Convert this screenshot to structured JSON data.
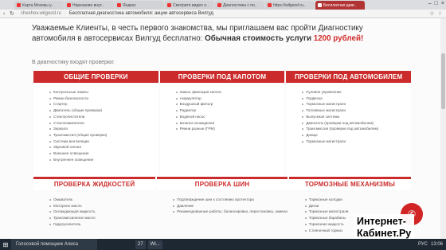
{
  "browser": {
    "tabs": [
      {
        "label": "Карта Москвы у.."
      },
      {
        "label": "Нарезание внут.."
      },
      {
        "label": "Яндекс"
      },
      {
        "label": "Смотрите видео о.."
      },
      {
        "label": "Диагностика с по.."
      },
      {
        "label": "https://wilgood.ru.."
      },
      {
        "label": "Бесплатная диаг.."
      }
    ],
    "active_tab_index": 6,
    "window_controls": [
      "–",
      "□",
      "×"
    ],
    "url": "chexhov.wilgood.ru",
    "page_title": "Бесплатная диагностика автомобиля: акции автосервиса Вилгуд"
  },
  "page": {
    "intro_text": "Уважаемые Клиенты, в честь первого знакомства, мы приглашаем вас пройти Диагностику автомобиля в автосервисах Вилгуд бесплатно:",
    "intro_bold": "Обычная стоимость услуги",
    "intro_price": "1200 рублей!",
    "diagnostics_caption": "В диагностику входят проверки:",
    "top_sections": [
      {
        "title": "ОБЩИЕ ПРОВЕРКИ",
        "items": [
          "Контрольные лампы",
          "Ремни безопасности",
          "Стартер",
          "Двигатель (общие проверки)",
          "Стеклоочистители",
          "Стеклоомыватели",
          "Зеркала",
          "Трансмиссия (общие проверки)",
          "Система вентиляции",
          "Звуковой сигнал",
          "Внешнее освещение",
          "Внутреннее освещение"
        ]
      },
      {
        "title": "ПРОВЕРКИ ПОД КАПОТОМ",
        "items": [
          "Замок, фиксация капота",
          "Аккумулятор",
          "Воздушный фильтр",
          "Радиатор",
          "Водяной насос",
          "Шланги охлаждения",
          "Ремни разные (ГРМ)"
        ]
      },
      {
        "title": "ПРОВЕРКИ ПОД АВТОМОБИЛЕМ",
        "items": [
          "Рулевое управление",
          "Подвеска",
          "Тормозные магистрали",
          "Топливные магистрали",
          "Выпускная система",
          "Двигатель (проверки под автомобилем)",
          "Трансмиссия (проверки под автомобилем)",
          "Днище",
          "Тормозные магистрали"
        ]
      }
    ],
    "bottom_sections": [
      {
        "title": "ПРОВЕРКА ЖИДКОСТЕЙ",
        "items": [
          "Омыватель",
          "Моторное масло",
          "Охлаждающая жидкость",
          "Трансмиссионное масло",
          "Гидроусилитель"
        ]
      },
      {
        "title": "ПРОВЕРКА ШИН",
        "items": [
          "Подтверждение шин к состоянию протектора",
          "Давление",
          "Рекомендованные работы: балансировка, перестановка, замена"
        ]
      },
      {
        "title": "ТОРМОЗНЫЕ МЕХАНИЗМЫ",
        "items": [
          "Тормозные колодки",
          "Диски",
          "Тормозные магистрали",
          "Тормозные барабаны",
          "Тормозная жидкость",
          "Стояночный тормоз"
        ]
      }
    ],
    "fab_icon": "phone-icon",
    "brand_color": "#cc2b2b"
  },
  "watermark": {
    "line1": "Интернет-",
    "line2": "Кабинет.Ру"
  },
  "taskbar": {
    "search_placeholder": "Голосовой помощник Алиса",
    "apps": [
      "27",
      "",
      "",
      "Wi...",
      "",
      "",
      "",
      "",
      ""
    ],
    "time": "13:06",
    "lang": "РУС"
  }
}
